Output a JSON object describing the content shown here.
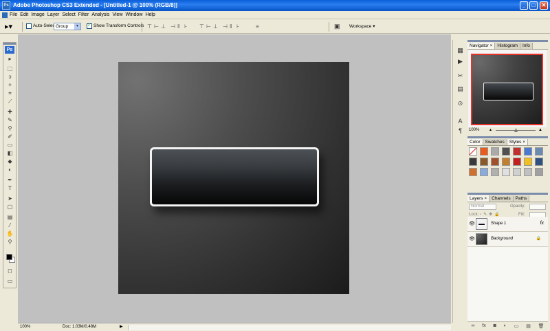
{
  "window": {
    "title": "Adobe Photoshop CS3 Extended - [Untitled-1 @ 100% (RGB/8)]",
    "app_icon_text": "Ps",
    "minimize": "_",
    "maximize": "□",
    "close": "✕"
  },
  "menu": [
    "File",
    "Edit",
    "Image",
    "Layer",
    "Select",
    "Filter",
    "Analysis",
    "View",
    "Window",
    "Help"
  ],
  "options": {
    "tool_icon": "move-tool-icon",
    "auto_select_label": "Auto-Select:",
    "auto_select_checked": false,
    "auto_select_value": "Group",
    "transform_label": "Show Transform Controls",
    "transform_checked": true,
    "align_glyphs": [
      "⊤",
      "⊢",
      "⊥",
      "⊣",
      "‖",
      "⊦",
      "⊤",
      "⊢",
      "⊥",
      "⊣",
      "‖",
      "⊦",
      "≡"
    ],
    "workspace_label": "Workspace ▾"
  },
  "toolbox": {
    "logo": "Ps",
    "tools": [
      {
        "name": "move-tool-icon",
        "glyph": "▸"
      },
      {
        "name": "marquee-tool-icon",
        "glyph": "⬚"
      },
      {
        "name": "lasso-tool-icon",
        "glyph": "ↄ"
      },
      {
        "name": "magic-wand-tool-icon",
        "glyph": "✧"
      },
      {
        "name": "crop-tool-icon",
        "glyph": "⌗"
      },
      {
        "name": "slice-tool-icon",
        "glyph": "⟋"
      },
      {
        "name": "healing-brush-tool-icon",
        "glyph": "✚"
      },
      {
        "name": "brush-tool-icon",
        "glyph": "✎"
      },
      {
        "name": "clone-stamp-tool-icon",
        "glyph": "⚲"
      },
      {
        "name": "history-brush-tool-icon",
        "glyph": "✐"
      },
      {
        "name": "eraser-tool-icon",
        "glyph": "▭"
      },
      {
        "name": "gradient-tool-icon",
        "glyph": "◧"
      },
      {
        "name": "blur-tool-icon",
        "glyph": "◆"
      },
      {
        "name": "dodge-tool-icon",
        "glyph": "◐"
      },
      {
        "name": "pen-tool-icon",
        "glyph": "✒"
      },
      {
        "name": "type-tool-icon",
        "glyph": "T"
      },
      {
        "name": "path-selection-tool-icon",
        "glyph": "➤"
      },
      {
        "name": "shape-tool-icon",
        "glyph": "▢"
      },
      {
        "name": "notes-tool-icon",
        "glyph": "▤"
      },
      {
        "name": "eyedropper-tool-icon",
        "glyph": "⁄"
      },
      {
        "name": "hand-tool-icon",
        "glyph": "✋"
      },
      {
        "name": "zoom-tool-icon",
        "glyph": "⚲"
      }
    ],
    "foreground_color": "#000000",
    "background_color": "#ffffff",
    "quick_mask_icon": "quick-mask-icon",
    "screen_mode_icon": "screen-mode-icon"
  },
  "status": {
    "zoom": "100%",
    "doc": "Doc: 1.03M/0.48M"
  },
  "dock_icons": [
    "history-icon",
    "actions-icon",
    "tool-presets-icon",
    "brushes-icon",
    "clone-source-icon",
    "character-icon",
    "paragraph-icon"
  ],
  "navigator": {
    "tabs": [
      "Navigator ×",
      "Histogram",
      "Info"
    ],
    "zoom": "100%",
    "view_box_color": "#e63229",
    "zoom_level": 0.5
  },
  "styles_panel": {
    "tabs": [
      "Color",
      "Swatches",
      "Styles ×"
    ],
    "swatches": [
      "#ffffff",
      "#e85a1e",
      "#aaaaaa",
      "#505050",
      "#c03030",
      "#4a7ad0",
      "#6a8ab0",
      "#3a3a3a",
      "#8a5a2a",
      "#a0522d",
      "#c08030",
      "#c02020",
      "#f0c020",
      "#305080",
      "#d07030",
      "#88aadd",
      "#b0b0b0",
      "#e0e0e0",
      "#d0d0d0",
      "#c0c0c0",
      "#a0a0a0"
    ]
  },
  "layers": {
    "tabs": [
      "Layers ×",
      "Channels",
      "Paths"
    ],
    "blend_mode": "Normal",
    "opacity_label": "Opacity:",
    "lock_label": "Lock:",
    "fill_label": "Fill:",
    "rows": [
      {
        "name": "Shape 1",
        "fx": "fx",
        "lock": "",
        "italic": false
      },
      {
        "name": "Background",
        "fx": "",
        "lock": "🔒",
        "italic": true
      }
    ],
    "footer_icons": [
      "∞",
      "fx",
      "◙",
      "◐",
      "▭",
      "▤",
      "🗑"
    ]
  }
}
